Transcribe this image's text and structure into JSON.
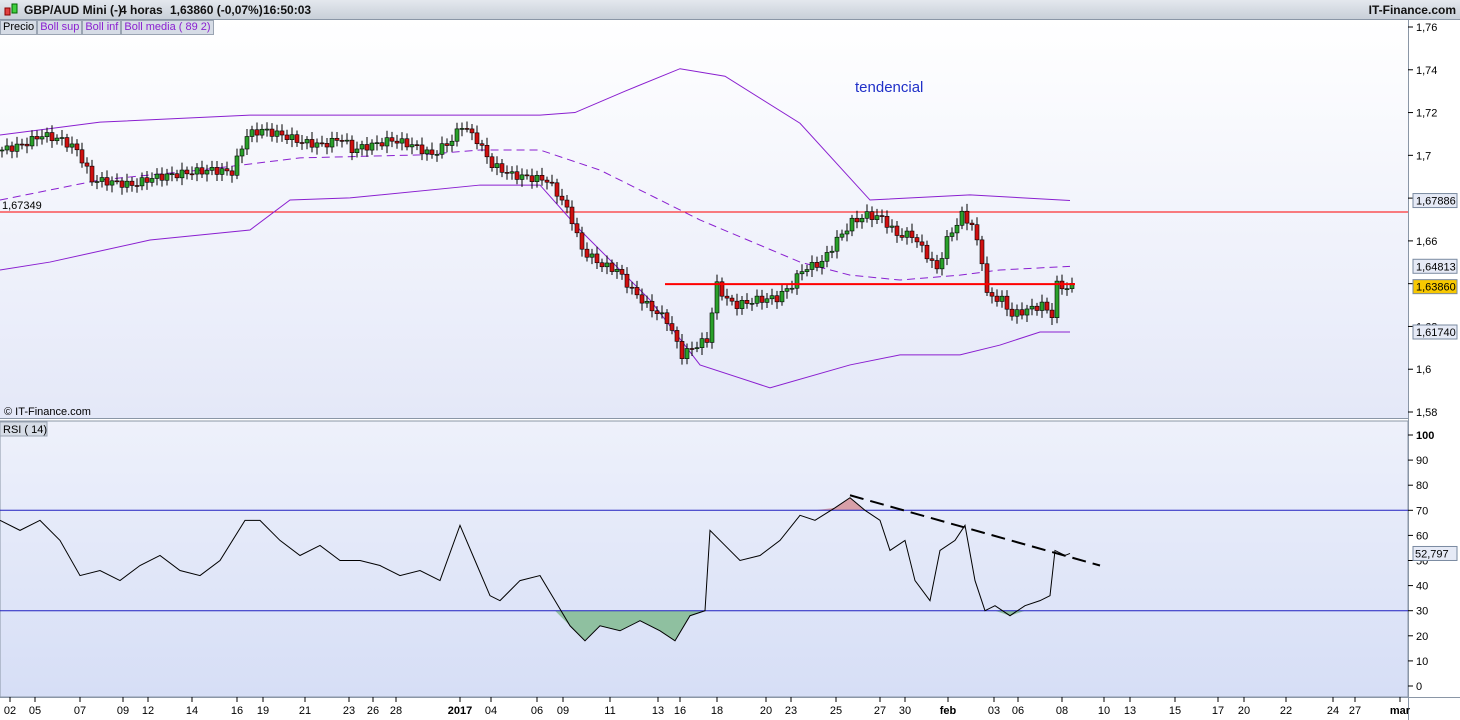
{
  "header": {
    "symbol": "GBP/AUD Mini (-)",
    "timeframe": "4 horas",
    "price": "1,63860 (-0,07%)",
    "time": "16:50:03",
    "brand": "IT-Finance.com"
  },
  "legend": [
    "Precio",
    "Boll sup",
    "Boll inf",
    "Boll media ( 89 2)"
  ],
  "watermark": "© IT-Finance.com",
  "rsi_label": "RSI ( 14)",
  "annotation": "tendencial",
  "colors": {
    "up": "#2aa02a",
    "down": "#d01010",
    "bands": "#8a1fd0",
    "level": "#ff0000",
    "rsi_lines": "#2020c0"
  },
  "chart_data": [
    {
      "type": "candlestick",
      "title": "GBP/AUD Mini (-) 4 horas",
      "ylim": [
        1.58,
        1.76
      ],
      "yticks": [
        "1,58",
        "1,6",
        "1,62",
        "1,64",
        "1,66",
        "1,68",
        "1,7",
        "1,72",
        "1,74",
        "1,76"
      ],
      "xticks": [
        "02",
        "05",
        "07",
        "09",
        "12",
        "14",
        "16",
        "19",
        "21",
        "23",
        "26",
        "28",
        "2017",
        "04",
        "06",
        "09",
        "11",
        "13",
        "16",
        "18",
        "20",
        "23",
        "25",
        "27",
        "30",
        "feb",
        "03",
        "06",
        "08",
        "10",
        "13",
        "15",
        "17",
        "20",
        "22",
        "24",
        "27",
        "mar"
      ],
      "close": [
        [
          0,
          1.7025
        ],
        [
          4,
          1.7048
        ],
        [
          8,
          1.7095
        ],
        [
          12,
          1.7072
        ],
        [
          15,
          1.7025
        ],
        [
          18,
          1.6885
        ],
        [
          22,
          1.6875
        ],
        [
          26,
          1.6861
        ],
        [
          30,
          1.6894
        ],
        [
          34,
          1.6908
        ],
        [
          38,
          1.6922
        ],
        [
          42,
          1.6931
        ],
        [
          46,
          1.6922
        ],
        [
          49,
          1.7095
        ],
        [
          52,
          1.7118
        ],
        [
          56,
          1.7095
        ],
        [
          60,
          1.7062
        ],
        [
          64,
          1.7048
        ],
        [
          68,
          1.7081
        ],
        [
          70,
          1.7025
        ],
        [
          74,
          1.7048
        ],
        [
          78,
          1.7072
        ],
        [
          82,
          1.7048
        ],
        [
          86,
          1.7002
        ],
        [
          90,
          1.7072
        ],
        [
          92,
          1.7142
        ],
        [
          95,
          1.7072
        ],
        [
          98,
          1.6955
        ],
        [
          102,
          1.6908
        ],
        [
          106,
          1.6894
        ],
        [
          109,
          1.6885
        ],
        [
          112,
          1.6791
        ],
        [
          114,
          1.6698
        ],
        [
          116,
          1.6557
        ],
        [
          120,
          1.6487
        ],
        [
          123,
          1.6464
        ],
        [
          126,
          1.637
        ],
        [
          129,
          1.63
        ],
        [
          133,
          1.623
        ],
        [
          136,
          1.6067
        ],
        [
          139,
          1.6113
        ],
        [
          141,
          1.6137
        ],
        [
          143,
          1.6394
        ],
        [
          145,
          1.6324
        ],
        [
          147,
          1.63
        ],
        [
          151,
          1.6324
        ],
        [
          155,
          1.6333
        ],
        [
          158,
          1.6394
        ],
        [
          160,
          1.6464
        ],
        [
          164,
          1.6501
        ],
        [
          167,
          1.6604
        ],
        [
          170,
          1.6688
        ],
        [
          173,
          1.6721
        ],
        [
          176,
          1.6707
        ],
        [
          179,
          1.6628
        ],
        [
          182,
          1.6628
        ],
        [
          185,
          1.6534
        ],
        [
          187,
          1.6464
        ],
        [
          189,
          1.6604
        ],
        [
          192,
          1.6721
        ],
        [
          194,
          1.6674
        ],
        [
          196,
          1.6511
        ],
        [
          197,
          1.6347
        ],
        [
          200,
          1.6324
        ],
        [
          202,
          1.6254
        ],
        [
          205,
          1.6277
        ],
        [
          208,
          1.63
        ],
        [
          210,
          1.6254
        ],
        [
          211,
          1.6394
        ],
        [
          213,
          1.638
        ],
        [
          214,
          1.6386
        ]
      ],
      "boll_sup": [
        [
          0,
          1.7095
        ],
        [
          20,
          1.7155
        ],
        [
          50,
          1.7188
        ],
        [
          108,
          1.7188
        ],
        [
          115,
          1.72
        ],
        [
          125,
          1.73
        ],
        [
          136,
          1.7405
        ],
        [
          145,
          1.737
        ],
        [
          160,
          1.715
        ],
        [
          174,
          1.6791
        ],
        [
          194,
          1.6815
        ],
        [
          214,
          1.6789
        ]
      ],
      "boll_inf": [
        [
          0,
          1.6464
        ],
        [
          10,
          1.6501
        ],
        [
          30,
          1.6604
        ],
        [
          50,
          1.6651
        ],
        [
          58,
          1.6791
        ],
        [
          70,
          1.6801
        ],
        [
          96,
          1.6861
        ],
        [
          108,
          1.6861
        ],
        [
          116,
          1.6651
        ],
        [
          130,
          1.6324
        ],
        [
          140,
          1.602
        ],
        [
          154,
          1.5913
        ],
        [
          170,
          1.602
        ],
        [
          180,
          1.6067
        ],
        [
          192,
          1.6067
        ],
        [
          200,
          1.6113
        ],
        [
          208,
          1.6174
        ],
        [
          214,
          1.6174
        ]
      ],
      "boll_media": [
        [
          0,
          1.6791
        ],
        [
          20,
          1.6885
        ],
        [
          40,
          1.6931
        ],
        [
          60,
          1.6988
        ],
        [
          84,
          1.7002
        ],
        [
          96,
          1.7025
        ],
        [
          108,
          1.7025
        ],
        [
          120,
          1.6931
        ],
        [
          140,
          1.6698
        ],
        [
          160,
          1.6501
        ],
        [
          170,
          1.644
        ],
        [
          180,
          1.6417
        ],
        [
          192,
          1.644
        ],
        [
          200,
          1.6464
        ],
        [
          214,
          1.6481
        ]
      ],
      "levels": [
        {
          "value": 1.67349,
          "label": "1,67349"
        }
      ],
      "resistance": {
        "from": 133,
        "to": 215,
        "value": 1.6398
      },
      "markers": [
        {
          "label": "1,67886",
          "kind": "band"
        },
        {
          "label": "1,64813",
          "kind": "band"
        },
        {
          "label": "1,63860",
          "kind": "price"
        },
        {
          "label": "1,61740",
          "kind": "band"
        }
      ]
    },
    {
      "type": "line",
      "title": "RSI ( 14)",
      "ylim": [
        0,
        100
      ],
      "yticks": [
        "0",
        "10",
        "20",
        "30",
        "40",
        "50",
        "60",
        "70",
        "80",
        "90",
        "100"
      ],
      "levels": [
        30,
        70
      ],
      "values": [
        [
          0,
          66
        ],
        [
          4,
          62
        ],
        [
          8,
          66
        ],
        [
          12,
          58
        ],
        [
          16,
          44
        ],
        [
          20,
          46
        ],
        [
          24,
          42
        ],
        [
          28,
          48
        ],
        [
          32,
          52
        ],
        [
          36,
          46
        ],
        [
          40,
          44
        ],
        [
          44,
          50
        ],
        [
          49,
          66
        ],
        [
          52,
          66
        ],
        [
          56,
          58
        ],
        [
          60,
          52
        ],
        [
          64,
          56
        ],
        [
          68,
          50
        ],
        [
          72,
          50
        ],
        [
          76,
          48
        ],
        [
          80,
          44
        ],
        [
          84,
          46
        ],
        [
          88,
          42
        ],
        [
          92,
          64
        ],
        [
          95,
          50
        ],
        [
          98,
          36
        ],
        [
          100,
          34
        ],
        [
          104,
          42
        ],
        [
          108,
          44
        ],
        [
          111,
          34
        ],
        [
          114,
          24
        ],
        [
          117,
          18
        ],
        [
          120,
          24
        ],
        [
          124,
          22
        ],
        [
          128,
          26
        ],
        [
          132,
          22
        ],
        [
          135,
          18
        ],
        [
          138,
          28
        ],
        [
          141,
          30
        ],
        [
          142,
          62
        ],
        [
          145,
          56
        ],
        [
          148,
          50
        ],
        [
          152,
          52
        ],
        [
          156,
          58
        ],
        [
          160,
          68
        ],
        [
          163,
          66
        ],
        [
          167,
          71
        ],
        [
          170,
          75
        ],
        [
          173,
          70
        ],
        [
          176,
          66
        ],
        [
          178,
          54
        ],
        [
          181,
          58
        ],
        [
          183,
          42
        ],
        [
          186,
          34
        ],
        [
          188,
          54
        ],
        [
          191,
          58
        ],
        [
          193,
          64
        ],
        [
          195,
          42
        ],
        [
          197,
          30
        ],
        [
          199,
          32
        ],
        [
          202,
          28
        ],
        [
          205,
          32
        ],
        [
          208,
          34
        ],
        [
          210,
          36
        ],
        [
          211,
          54
        ],
        [
          213,
          52
        ],
        [
          214,
          52.8
        ]
      ],
      "trendline": {
        "from": [
          170,
          76
        ],
        "to": [
          220,
          48
        ]
      },
      "marker": "52,797"
    }
  ]
}
